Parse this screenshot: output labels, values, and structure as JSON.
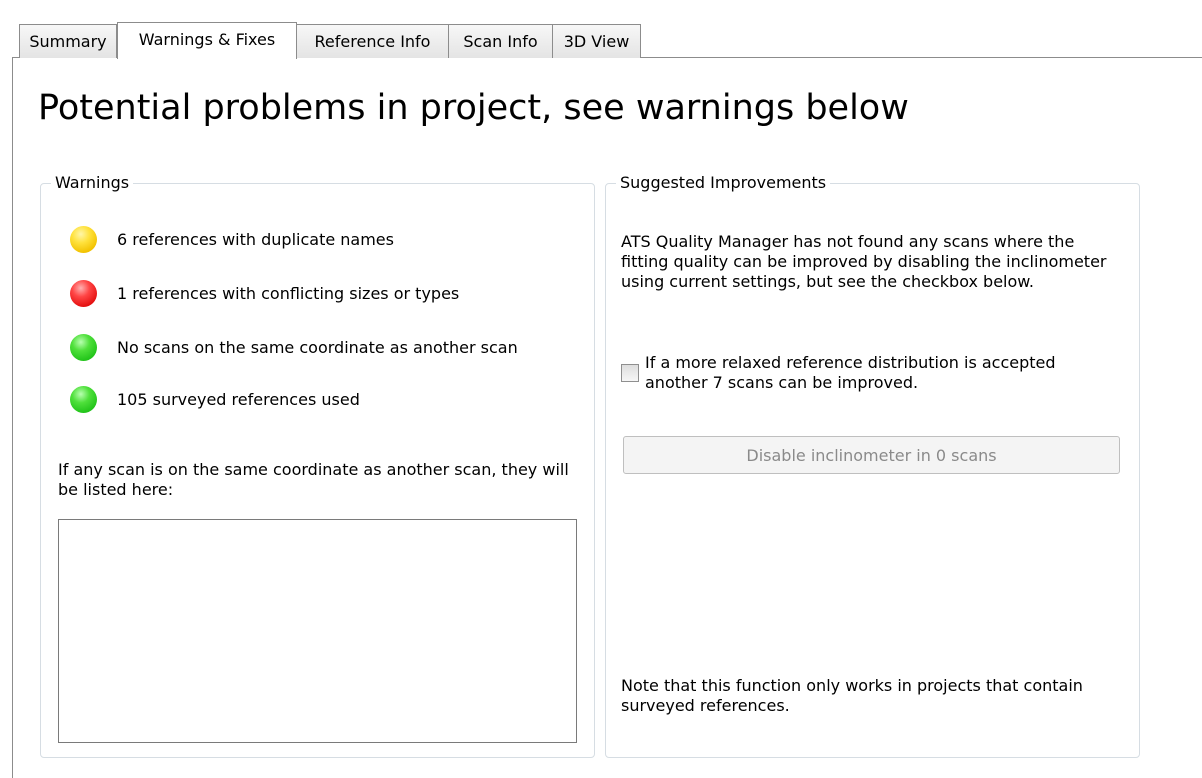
{
  "tabs": {
    "summary": "Summary",
    "warnings": "Warnings & Fixes",
    "reference_info": "Reference Info",
    "scan_info": "Scan Info",
    "view3d": "3D View"
  },
  "page_title": "Potential problems in project, see warnings below",
  "warnings": {
    "legend": "Warnings",
    "items": [
      {
        "status": "yellow",
        "text": "6 references with duplicate names"
      },
      {
        "status": "red",
        "text": "1 references with conflicting sizes or types"
      },
      {
        "status": "green",
        "text": "No scans on the same coordinate as another scan"
      },
      {
        "status": "green",
        "text": "105 surveyed references used"
      }
    ],
    "list_caption": "If any scan is on the same coordinate as another scan, they will be listed here:"
  },
  "improvements": {
    "legend": "Suggested Improvements",
    "description": "ATS Quality Manager has not found any scans where the fitting quality can be improved by disabling the inclinometer using current settings, but see the checkbox below.",
    "checkbox_label": "If a more relaxed reference distribution is accepted another 7 scans can be improved.",
    "checkbox_checked": false,
    "button_label": "Disable inclinometer in 0 scans",
    "button_enabled": false,
    "note": "Note that this function only works in projects that contain surveyed references."
  },
  "colors": {
    "yellow": "#f2c200",
    "red": "#e41010",
    "green": "#22c41a",
    "groupbox_border": "#d6dde3"
  }
}
